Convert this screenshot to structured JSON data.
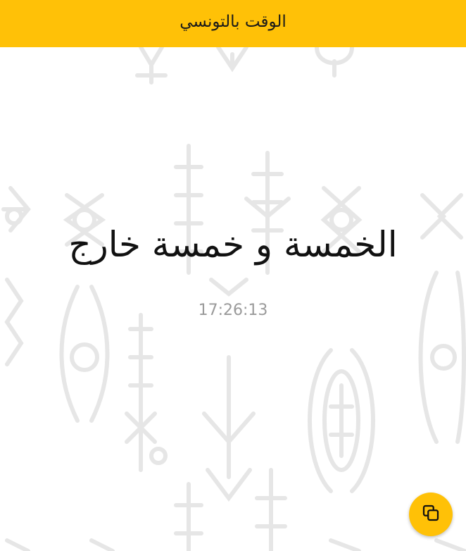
{
  "header": {
    "title": "الوقت بالتونسي"
  },
  "main": {
    "time_phrase": "الخمسة و خمسة خارج",
    "digital_time": "17:26:13"
  },
  "fab": {
    "icon": "copy-icon"
  },
  "colors": {
    "accent": "#FFC107",
    "pattern": "#e9e9e9",
    "text": "#111111",
    "muted": "#9a9a9a"
  }
}
